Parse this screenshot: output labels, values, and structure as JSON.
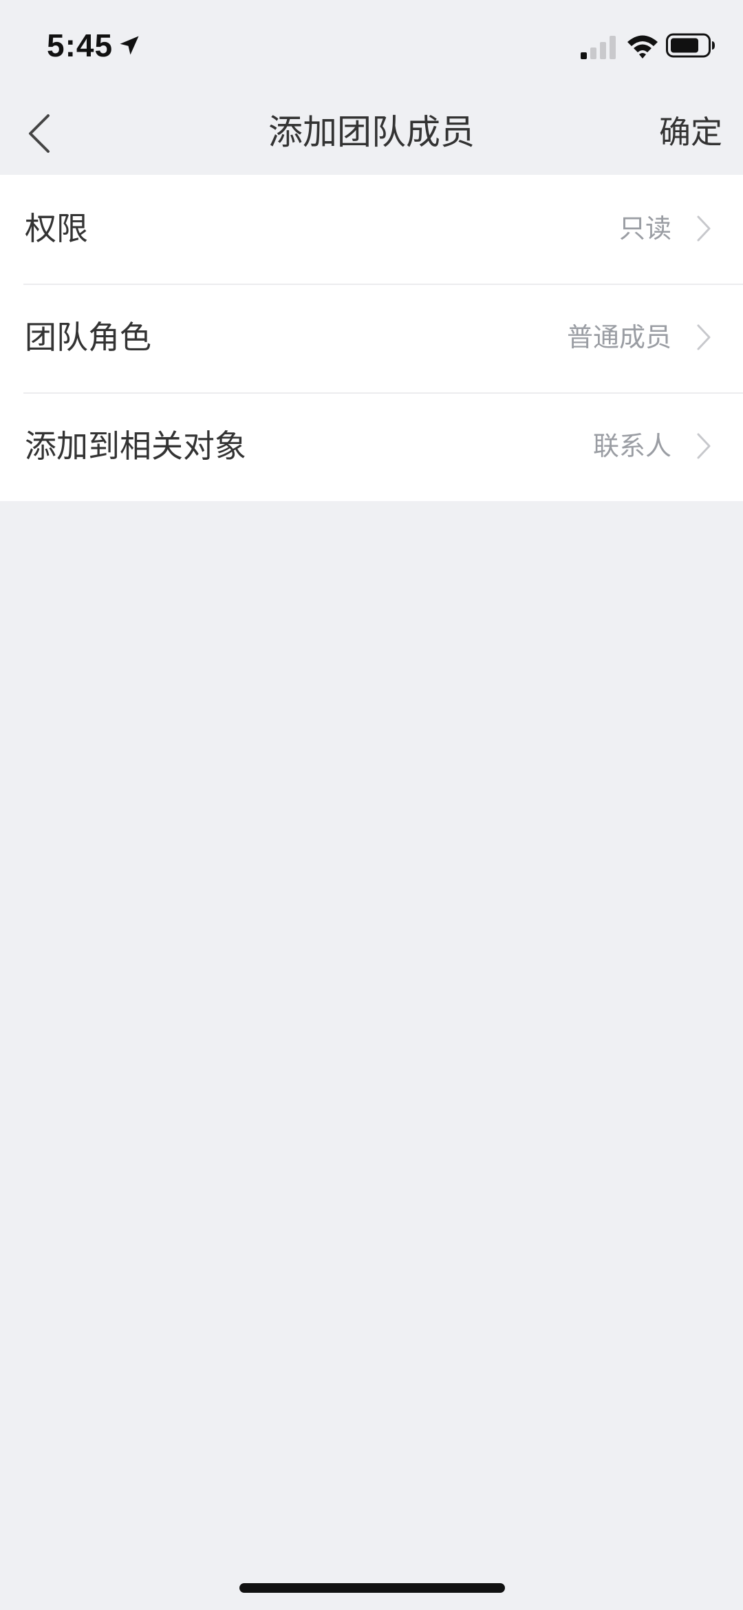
{
  "status_bar": {
    "time": "5:45",
    "icons": [
      "location-arrow-icon",
      "cellular-signal-icon",
      "wifi-icon",
      "battery-icon"
    ]
  },
  "nav": {
    "back_icon": "chevron-left-icon",
    "title": "添加团队成员",
    "confirm_label": "确定"
  },
  "settings": [
    {
      "label": "权限",
      "value": "只读"
    },
    {
      "label": "团队角色",
      "value": "普通成员"
    },
    {
      "label": "添加到相关对象",
      "value": "联系人"
    }
  ],
  "colors": {
    "background": "#eff0f3",
    "card": "#ffffff",
    "primary_text": "#333333",
    "secondary_text": "#9a9da3",
    "chevron": "#c7c8cc",
    "divider": "#ececee"
  }
}
